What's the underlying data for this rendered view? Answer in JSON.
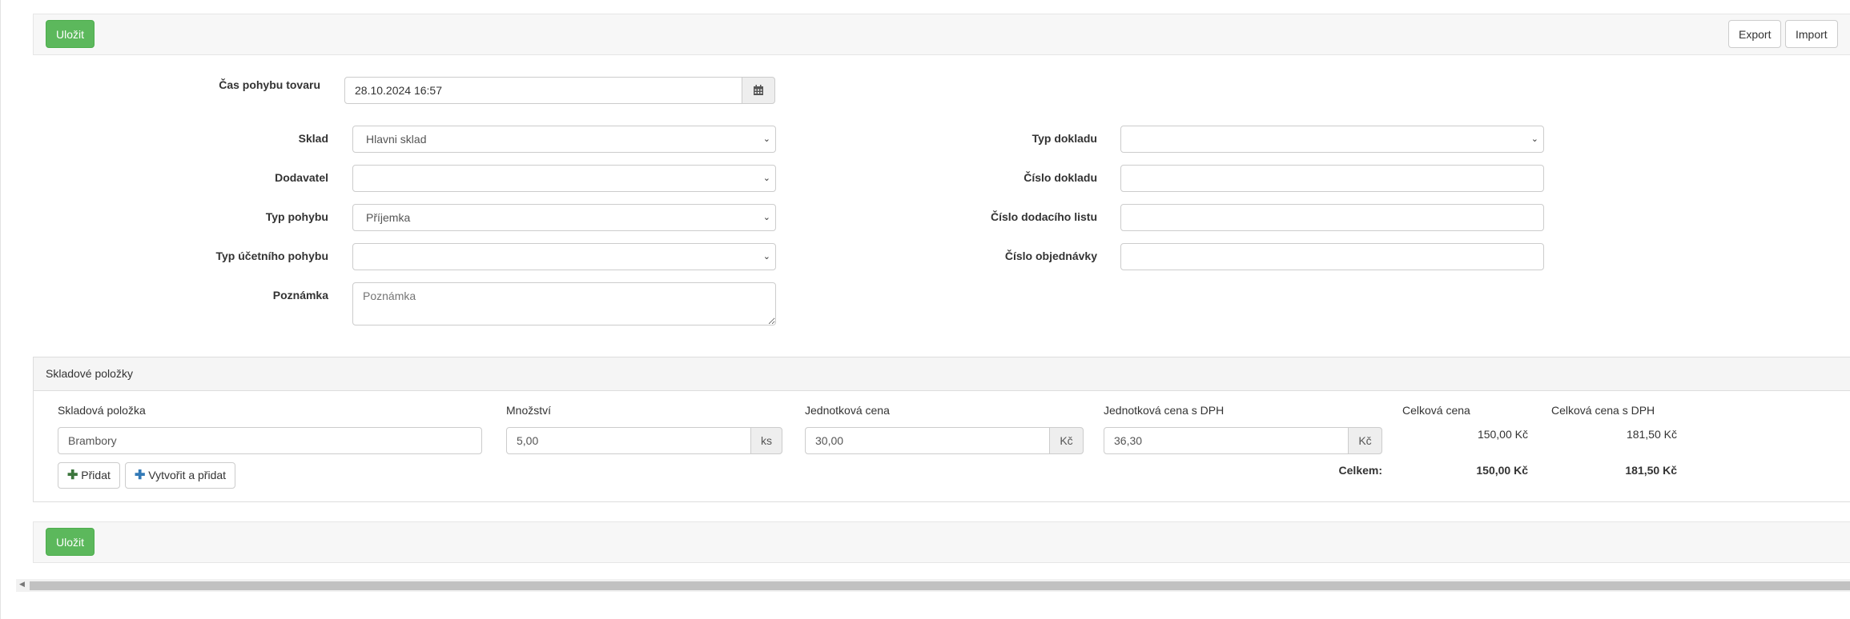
{
  "toolbar": {
    "save_label": "Uložit",
    "export_label": "Export",
    "import_label": "Import"
  },
  "form": {
    "time_label": "Čas pohybu tovaru",
    "time_value": "28.10.2024 16:57",
    "calendar_icon": "calendar-icon",
    "warehouse_label": "Sklad",
    "warehouse_value": "Hlavni sklad",
    "supplier_label": "Dodavatel",
    "supplier_value": "",
    "movement_type_label": "Typ pohybu",
    "movement_type_value": "Příjemka",
    "accounting_type_label": "Typ účetního pohybu",
    "accounting_type_value": "",
    "note_label": "Poznámka",
    "note_placeholder": "Poznámka",
    "doc_type_label": "Typ dokladu",
    "doc_type_value": "",
    "doc_number_label": "Číslo dokladu",
    "delivery_note_label": "Číslo dodacího listu",
    "order_number_label": "Číslo objednávky"
  },
  "items_panel": {
    "title": "Skladové položky",
    "headers": {
      "item": "Skladová položka",
      "quantity": "Množství",
      "unit_price": "Jednotková cena",
      "unit_price_vat": "Jednotková cena s DPH",
      "total": "Celková cena",
      "total_vat": "Celková cena s DPH"
    },
    "row": {
      "item": "Brambory",
      "quantity": "5,00",
      "quantity_unit": "ks",
      "unit_price": "30,00",
      "unit_price_currency": "Kč",
      "unit_price_vat": "36,30",
      "unit_price_vat_currency": "Kč",
      "total": "150,00 Kč",
      "total_vat": "181,50 Kč"
    },
    "add_label": "Přidat",
    "create_add_label": "Vytvořit a přidat",
    "sum_label": "Celkem:",
    "sum_total": "150,00 Kč",
    "sum_total_vat": "181,50 Kč"
  },
  "colors": {
    "success": "#5cb85c",
    "plus_green": "#3c763d",
    "plus_blue": "#337ab7"
  }
}
